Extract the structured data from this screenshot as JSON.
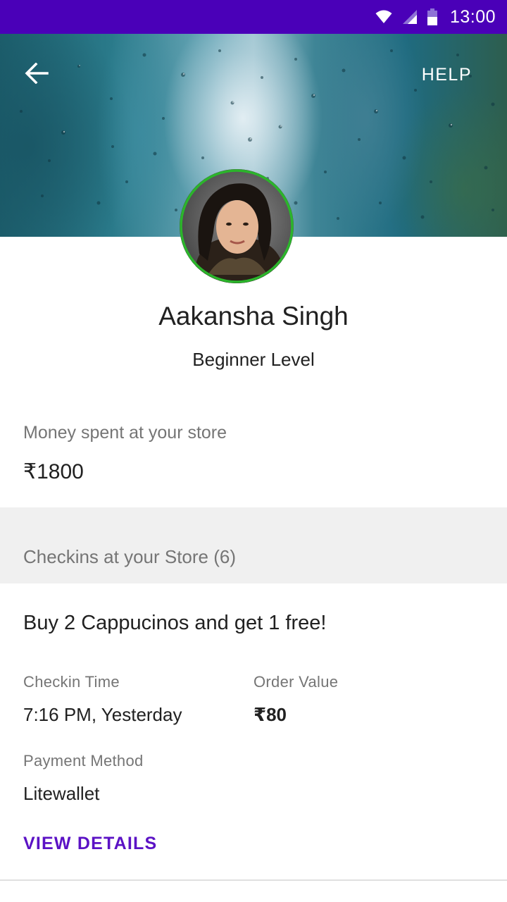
{
  "status_bar": {
    "time": "13:00",
    "icons": [
      "wifi-icon",
      "signal-icon",
      "battery-icon"
    ]
  },
  "header": {
    "back_icon": "arrow-left-icon",
    "help_label": "HELP"
  },
  "profile": {
    "name": "Aakansha Singh",
    "level": "Beginner Level",
    "ring_color": "#2bb52b"
  },
  "money": {
    "label": "Money spent at your store",
    "value": "₹1800"
  },
  "checkins": {
    "title": "Checkins at your Store (6)",
    "items": [
      {
        "offer": "Buy 2 Cappucinos and get 1 free!",
        "checkin_time_label": "Checkin Time",
        "checkin_time": "7:16 PM, Yesterday",
        "order_value_label": "Order Value",
        "order_value": "₹80",
        "payment_method_label": "Payment Method",
        "payment_method": "Litewallet",
        "action_label": "VIEW DETAILS"
      }
    ]
  },
  "colors": {
    "status_bar": "#4a00b8",
    "accent": "#5b12c5",
    "section_band": "#f0f0f0"
  }
}
